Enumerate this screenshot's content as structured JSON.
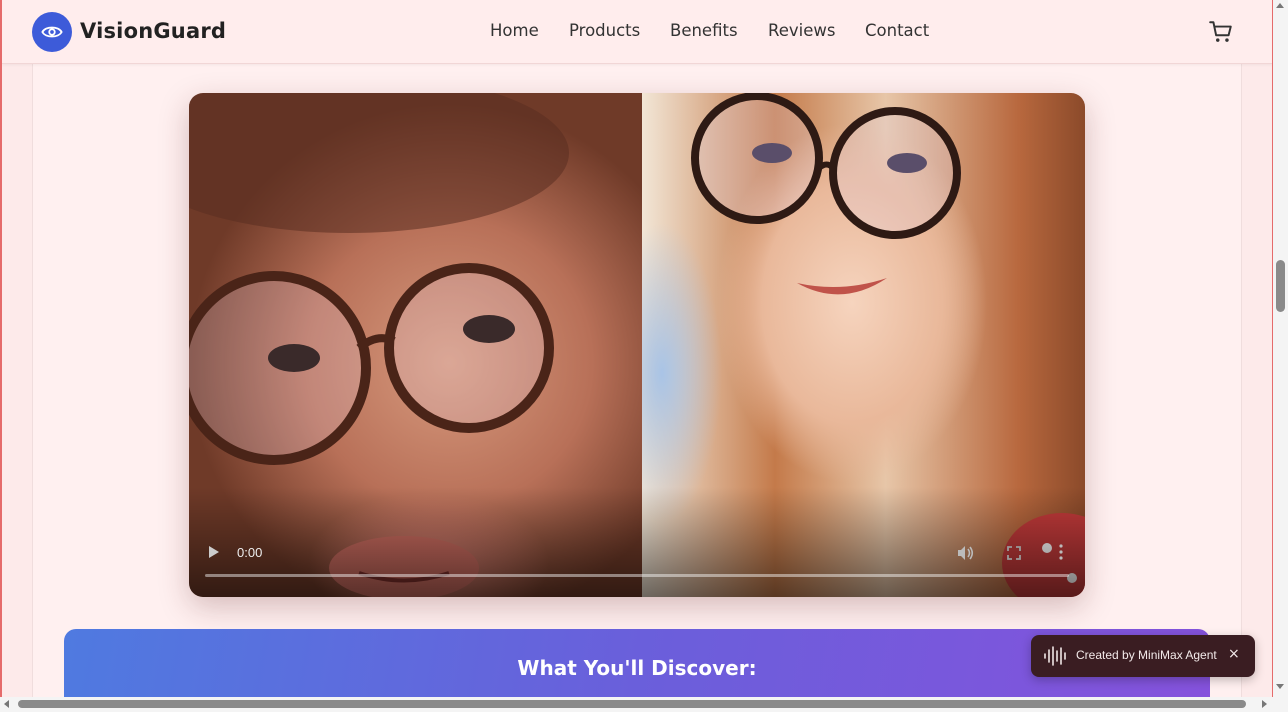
{
  "header": {
    "brand": "VisionGuard",
    "logo_icon": "eye-icon",
    "nav": [
      {
        "label": "Home"
      },
      {
        "label": "Products"
      },
      {
        "label": "Benefits"
      },
      {
        "label": "Reviews"
      },
      {
        "label": "Contact"
      }
    ],
    "cart_icon": "cart-icon"
  },
  "video": {
    "time": "0:00",
    "progress": 0,
    "controls": [
      "play-icon",
      "volume-icon",
      "fullscreen-icon",
      "more-options-icon"
    ]
  },
  "discover": {
    "title": "What You'll Discover:"
  },
  "toast": {
    "text": "Created by MiniMax Agent",
    "close": "×"
  },
  "colors": {
    "accent": "#3d5bd9",
    "background": "#fdeaea",
    "gradient_start": "#4f7ae0",
    "gradient_end": "#8552dc",
    "toast_bg": "#3a1d22"
  }
}
